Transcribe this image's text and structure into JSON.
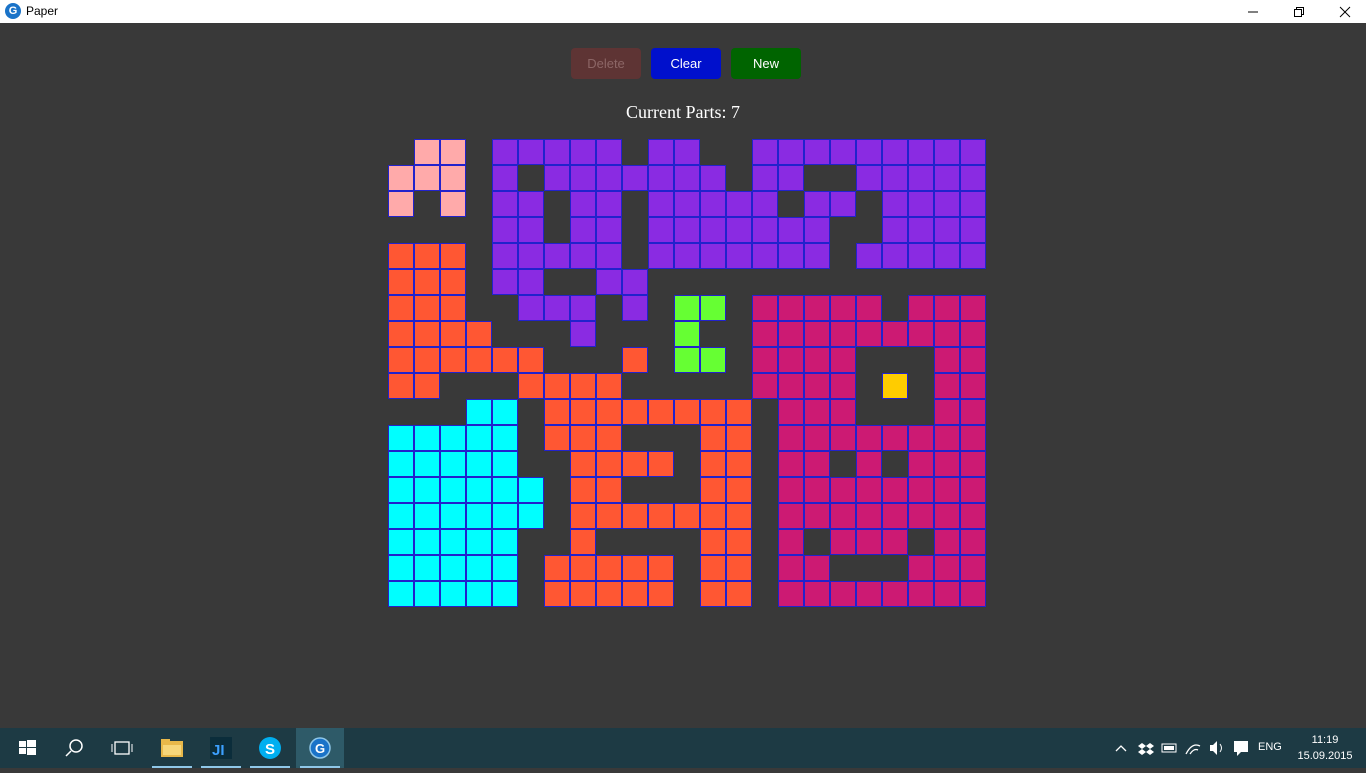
{
  "window": {
    "title": "Paper",
    "app_icon_glyph": "G"
  },
  "toolbar": {
    "delete_label": "Delete",
    "clear_label": "Clear",
    "new_label": "New"
  },
  "status": {
    "parts_label": "Current Parts: 7"
  },
  "board": {
    "columns": 23,
    "rows": 18,
    "background": "#393939",
    "border_color": "#2222cc",
    "parts": [
      {
        "name": "pink",
        "color": "#ffaaaa",
        "rows": [
          [
            1,
            1,
            2
          ],
          [
            0,
            0,
            2
          ],
          [
            0,
            0,
            0
          ],
          [
            2,
            2,
            2
          ]
        ]
      }
    ],
    "cells": [
      ".MM.PPPPP.PP..PPPPPPPPP",
      "MMM.P.PPPPPPP.PP..PPPPP",
      "M.M.PP.PP.PPPPP.PP.PPPP",
      "....PP.PP.PPPPPPP..PPPP",
      "OOO.PPPPP.PPPPPPP.PPPPP",
      "OOO.PP..PP.............",
      "OOO..PPP.P.GG.RRRRR.RRR",
      "OOOO...P...G..RRRRRRRRR",
      "OOOOOO...O.GG.RRRR...RR",
      "OO...OOOO.....RRRR.Y.RR",
      "...CC.OOOOOOOO.RRR...RR",
      "CCCCC.OOO...OO.RRRRRRRR",
      "CCCCC..OOOO.OO.RR.R.RRR",
      "CCCCCC.OO...OO.RRRRRRRR",
      "CCCCCC.OOOOOOO.RRRRRRRR",
      "CCCCC..O....OO.R.RRR.RR",
      "CCCCC.OOOOO.OO.RR...RRR",
      "CCCCC.OOOOO.OO.RRRRRRRR"
    ],
    "palette": {
      "M": "#ffaaaa",
      "P": "#8a2be2",
      "O": "#ff5733",
      "G": "#66ff33",
      "R": "#cc1a73",
      "Y": "#ffcc00",
      "C": "#00ffff"
    }
  },
  "taskbar": {
    "items": [
      {
        "name": "start-button-icon"
      },
      {
        "name": "search-icon"
      },
      {
        "name": "task-view-icon"
      },
      {
        "name": "file-explorer-icon"
      },
      {
        "name": "jetbrains-icon"
      },
      {
        "name": "skype-icon"
      },
      {
        "name": "paper-app-icon"
      }
    ],
    "language": "ENG",
    "time": "11:19",
    "date": "15.09.2015"
  }
}
